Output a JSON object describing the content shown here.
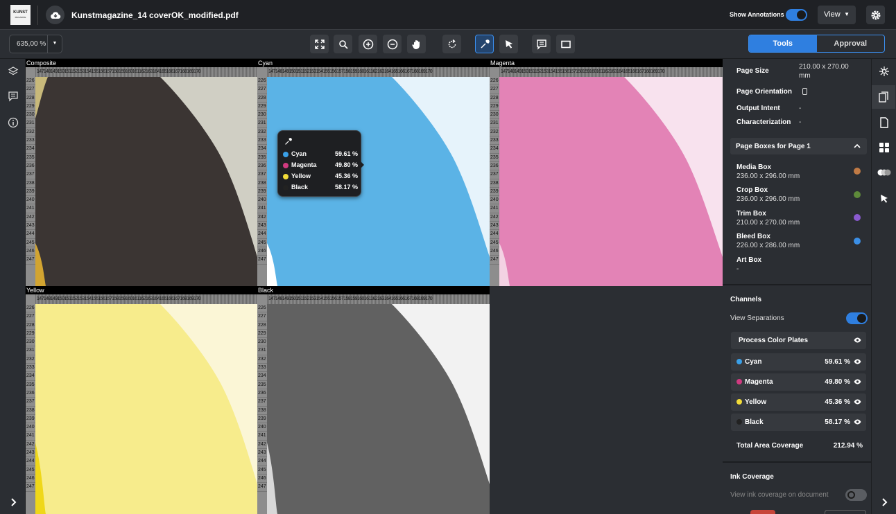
{
  "app": {
    "logo_text": "KUNST",
    "logo_sub": "MAGAZINE",
    "filename": "Kunstmagazine_14 coverOK_modified.pdf",
    "show_annotations_label": "Show Annotations",
    "view_label": "View",
    "zoom_value": "635,00",
    "zoom_unit": "%"
  },
  "tabs": {
    "tools": "Tools",
    "approval": "Approval"
  },
  "panels": {
    "composite": "Composite",
    "cyan": "Cyan",
    "magenta": "Magenta",
    "yellow": "Yellow",
    "black": "Black",
    "hruler": "147148149150151152153154155156157158159160161162163164165166167168169170",
    "vruler": [
      "226",
      "227",
      "228",
      "229",
      "230",
      "231",
      "232",
      "233",
      "234",
      "235",
      "236",
      "237",
      "238",
      "239",
      "240",
      "241",
      "242",
      "243",
      "244",
      "245",
      "246",
      "247"
    ]
  },
  "tooltip": {
    "rows": [
      {
        "name": "Cyan",
        "value": "59.61 %",
        "color": "#3aa0e8"
      },
      {
        "name": "Magenta",
        "value": "49.80 %",
        "color": "#d03a80"
      },
      {
        "name": "Yellow",
        "value": "45.36 %",
        "color": "#f2dc38"
      },
      {
        "name": "Black",
        "value": "58.17 %",
        "color": "#222222"
      }
    ]
  },
  "info": {
    "page_size_label": "Page Size",
    "page_size_value": "210.00 x 270.00",
    "page_size_unit": "mm",
    "orientation_label": "Page Orientation",
    "output_intent_label": "Output Intent",
    "output_intent_value": "-",
    "characterization_label": "Characterization",
    "characterization_value": "-"
  },
  "page_boxes": {
    "title": "Page Boxes for Page 1",
    "boxes": [
      {
        "name": "Media Box",
        "size": "236.00 x 296.00 mm",
        "color": "#c07a45"
      },
      {
        "name": "Crop Box",
        "size": "236.00 x 296.00 mm",
        "color": "#5e8a3a"
      },
      {
        "name": "Trim Box",
        "size": "210.00 x 270.00 mm",
        "color": "#8a5ad0"
      },
      {
        "name": "Bleed Box",
        "size": "226.00 x 286.00 mm",
        "color": "#3b8fe6"
      },
      {
        "name": "Art Box",
        "size": "-",
        "color": ""
      }
    ]
  },
  "channels": {
    "title": "Channels",
    "view_separations": "View Separations",
    "process_plates": "Process Color Plates",
    "items": [
      {
        "name": "Cyan",
        "value": "59.61 %",
        "color": "#3aa0e8"
      },
      {
        "name": "Magenta",
        "value": "49.80 %",
        "color": "#d03a80"
      },
      {
        "name": "Yellow",
        "value": "45.36 %",
        "color": "#f2dc38"
      },
      {
        "name": "Black",
        "value": "58.17 %",
        "color": "#222222"
      }
    ],
    "total_label": "Total Area Coverage",
    "total_value": "212.94 %"
  },
  "ink": {
    "title": "Ink Coverage",
    "toggle_label": "View ink coverage on document"
  }
}
